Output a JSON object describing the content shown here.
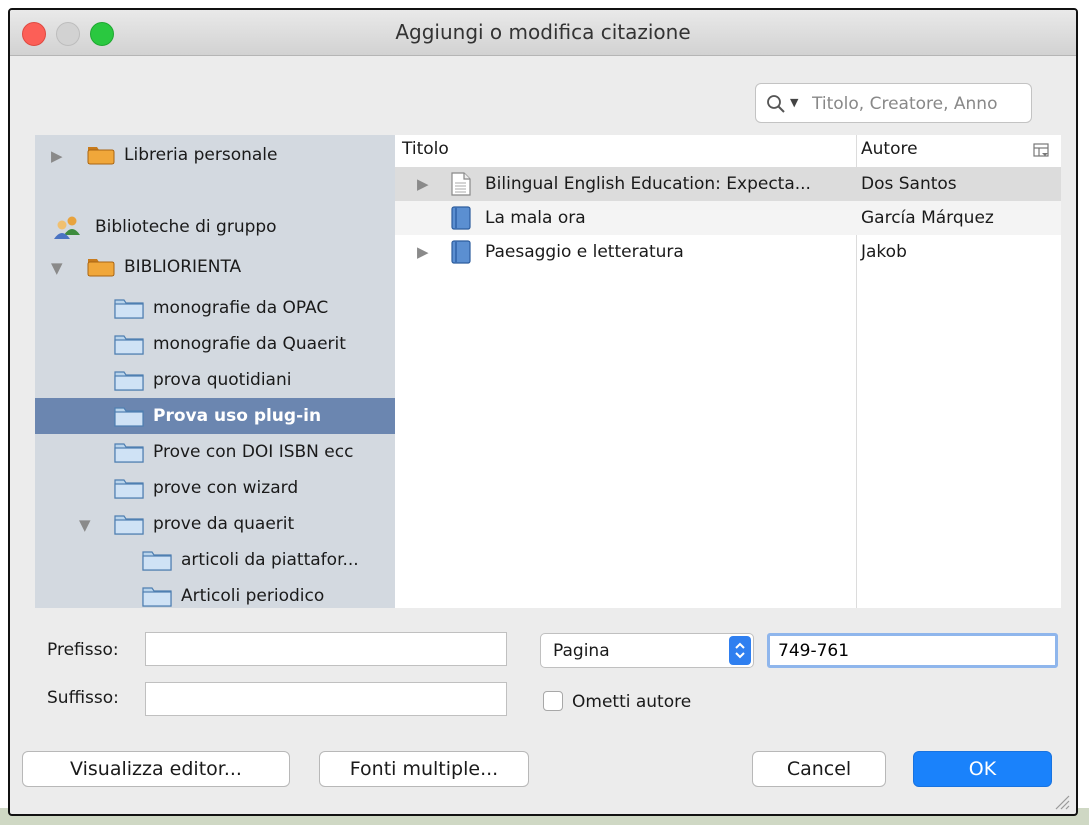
{
  "window": {
    "title": "Aggiungi o modifica citazione"
  },
  "search": {
    "placeholder": "Titolo, Creatore, Anno"
  },
  "sidebar": {
    "my_library": "Libreria personale",
    "group_libraries_header": "Biblioteche di gruppo",
    "group": "BIBLIORIENTA",
    "collections": [
      "monografie da OPAC",
      "monografie da Quaerit",
      "prova quotidiani",
      "Prova uso plug-in",
      "Prove con DOI ISBN ecc",
      "prove con wizard",
      "prove da quaerit"
    ],
    "subcollections": [
      "articoli da piattafor...",
      "Articoli periodico"
    ],
    "selected_collection": "Prova uso plug-in"
  },
  "items": {
    "columns": {
      "title": "Titolo",
      "author": "Autore"
    },
    "rows": [
      {
        "title": "Bilingual English Education: Expecta...",
        "author": "Dos Santos",
        "type": "document"
      },
      {
        "title": "La mala ora",
        "author": "García Márquez",
        "type": "book"
      },
      {
        "title": "Paesaggio e letteratura",
        "author": "Jakob",
        "type": "book"
      }
    ]
  },
  "form": {
    "prefix_label": "Prefisso:",
    "prefix_value": "",
    "suffix_label": "Suffisso:",
    "suffix_value": "",
    "locator_select": "Pagina",
    "locator_value": "749-761",
    "omit_author_label": "Ometti autore",
    "omit_author_checked": false
  },
  "buttons": {
    "show_editor": "Visualizza editor...",
    "multiple_sources": "Fonti multiple...",
    "cancel": "Cancel",
    "ok": "OK"
  },
  "colors": {
    "accent": "#1a82fb",
    "selection": "#6b86b0",
    "sidebar_bg": "#d3d9e0"
  }
}
